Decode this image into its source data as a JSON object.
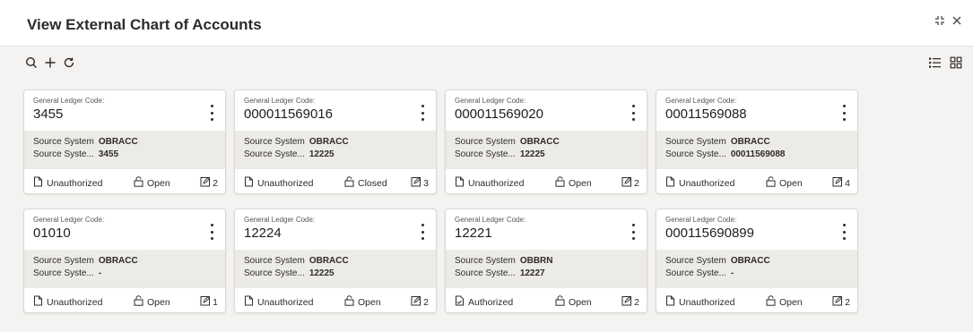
{
  "header": {
    "title": "View External Chart of Accounts"
  },
  "window_controls": [
    "minimize-icon",
    "close-icon"
  ],
  "toolbar": {
    "left_icons": [
      "search-icon",
      "add-icon",
      "refresh-icon"
    ],
    "right_icons": [
      "list-view-icon",
      "grid-view-icon"
    ]
  },
  "cards": [
    {
      "gl_label": "General Ledger Code:",
      "gl_code": "3455",
      "src_system_key": "Source System",
      "src_system": "OBRACC",
      "src_ref_key": "Source Syste...",
      "src_ref": "3455",
      "auth": "Unauthorized",
      "status": "Open",
      "mod_no": "2"
    },
    {
      "gl_label": "General Ledger Code:",
      "gl_code": "000011569016",
      "src_system_key": "Source System",
      "src_system": "OBRACC",
      "src_ref_key": "Source Syste...",
      "src_ref": "12225",
      "auth": "Unauthorized",
      "status": "Closed",
      "mod_no": "3"
    },
    {
      "gl_label": "General Ledger Code:",
      "gl_code": "000011569020",
      "src_system_key": "Source System",
      "src_system": "OBRACC",
      "src_ref_key": "Source Syste...",
      "src_ref": "12225",
      "auth": "Unauthorized",
      "status": "Open",
      "mod_no": "2"
    },
    {
      "gl_label": "General Ledger Code:",
      "gl_code": "00011569088",
      "src_system_key": "Source System",
      "src_system": "OBRACC",
      "src_ref_key": "Source Syste...",
      "src_ref": "00011569088",
      "auth": "Unauthorized",
      "status": "Open",
      "mod_no": "4"
    },
    {
      "gl_label": "General Ledger Code:",
      "gl_code": "01010",
      "src_system_key": "Source System",
      "src_system": "OBRACC",
      "src_ref_key": "Source Syste...",
      "src_ref": "-",
      "auth": "Unauthorized",
      "status": "Open",
      "mod_no": "1"
    },
    {
      "gl_label": "General Ledger Code:",
      "gl_code": "12224",
      "src_system_key": "Source System",
      "src_system": "OBRACC",
      "src_ref_key": "Source Syste...",
      "src_ref": "12225",
      "auth": "Unauthorized",
      "status": "Open",
      "mod_no": "2"
    },
    {
      "gl_label": "General Ledger Code:",
      "gl_code": "12221",
      "src_system_key": "Source System",
      "src_system": "OBBRN",
      "src_ref_key": "Source Syste...",
      "src_ref": "12227",
      "auth": "Authorized",
      "status": "Open",
      "mod_no": "2"
    },
    {
      "gl_label": "General Ledger Code:",
      "gl_code": "000115690899",
      "src_system_key": "Source System",
      "src_system": "OBRACC",
      "src_ref_key": "Source Syste...",
      "src_ref": "-",
      "auth": "Unauthorized",
      "status": "Open",
      "mod_no": "2"
    }
  ]
}
